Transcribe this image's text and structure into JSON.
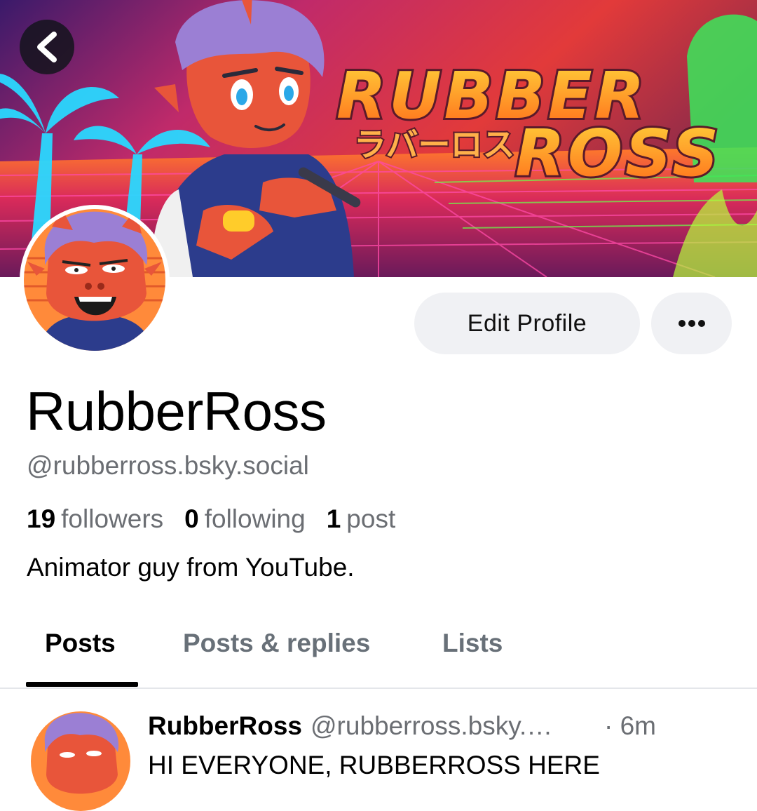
{
  "banner": {
    "title_line1": "RUBBER",
    "title_line2": "ROSS",
    "kana": "ラバーロス"
  },
  "header": {
    "back_icon": "chevron-left-icon"
  },
  "actions": {
    "edit_profile_label": "Edit Profile",
    "more_icon": "ellipsis-icon"
  },
  "profile": {
    "display_name": "RubberRoss",
    "handle": "@rubberross.bsky.social",
    "followers_count": "19",
    "followers_label": "followers",
    "following_count": "0",
    "following_label": "following",
    "posts_count": "1",
    "posts_label": "post",
    "bio": "Animator guy from YouTube."
  },
  "tabs": [
    {
      "label": "Posts",
      "active": true
    },
    {
      "label": "Posts & replies",
      "active": false
    },
    {
      "label": "Lists",
      "active": false
    }
  ],
  "post": {
    "author": "RubberRoss",
    "handle": "@rubberross.bsky.…",
    "time": "· 6m",
    "text": "HI EVERYONE, RUBBERROSS HERE"
  },
  "colors": {
    "muted_text": "#6b6e73",
    "button_bg": "#f0f1f4",
    "character_skin": "#e8553a",
    "character_hair": "#9b7fd4"
  }
}
